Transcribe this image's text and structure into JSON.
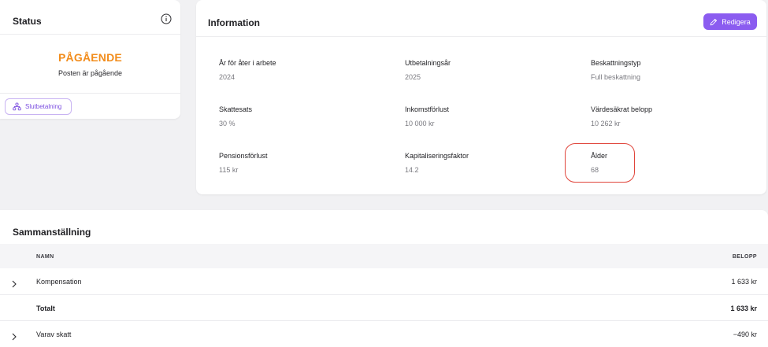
{
  "status": {
    "title": "Status",
    "value": "PÅGÅENDE",
    "description": "Posten är pågående",
    "final_payment_label": "Slutbetalning"
  },
  "information": {
    "title": "Information",
    "edit_label": "Redigera",
    "fields": [
      {
        "label": "År för åter i arbete",
        "value": "2024"
      },
      {
        "label": "Utbetalningsår",
        "value": "2025"
      },
      {
        "label": "Beskattningstyp",
        "value": "Full beskattning"
      },
      {
        "label": "Skattesats",
        "value": "30 %"
      },
      {
        "label": "Inkomstförlust",
        "value": "10 000 kr"
      },
      {
        "label": "Värdesäkrat belopp",
        "value": "10 262 kr"
      },
      {
        "label": "Pensionsförlust",
        "value": "115 kr"
      },
      {
        "label": "Kapitaliseringsfaktor",
        "value": "14.2"
      },
      {
        "label": "Ålder",
        "value": "68"
      }
    ]
  },
  "summary": {
    "title": "Sammanställning",
    "columns": {
      "name": "NAMN",
      "amount": "BELOPP"
    },
    "rows": [
      {
        "name": "Kompensation",
        "amount": "1 633 kr"
      },
      {
        "name": "Totalt",
        "amount": "1 633 kr"
      },
      {
        "name": "Varav skatt",
        "amount": "−490 kr"
      }
    ]
  },
  "colors": {
    "accent": "#8b5cf0",
    "status": "#f28c1b",
    "highlight": "#e0453b"
  },
  "icons": {
    "status_info": "info-circle-icon",
    "final_payment": "people-network-icon",
    "edit": "pencil-icon",
    "expand": "chevron-right-icon"
  }
}
